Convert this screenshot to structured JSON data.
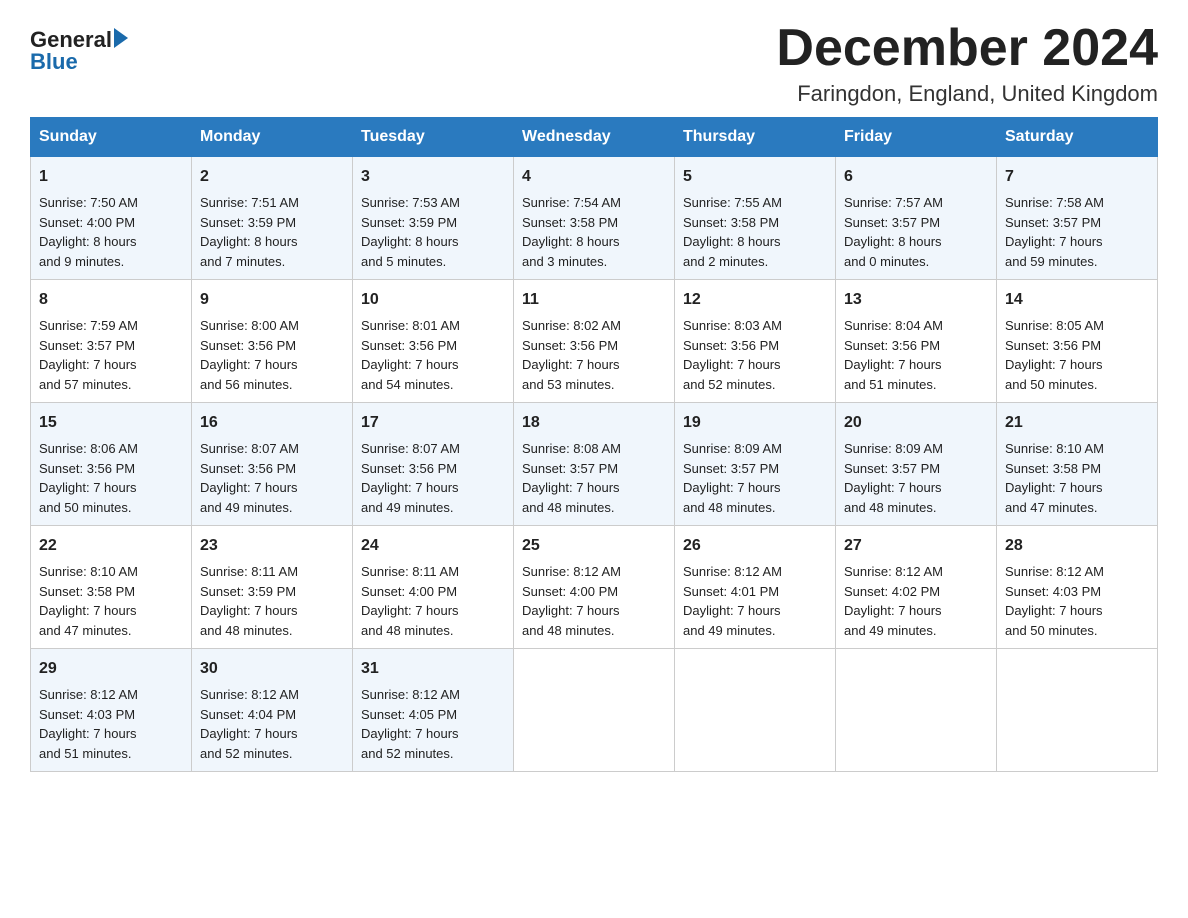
{
  "header": {
    "month_title": "December 2024",
    "location": "Faringdon, England, United Kingdom",
    "logo_general": "General",
    "logo_blue": "Blue"
  },
  "days_of_week": [
    "Sunday",
    "Monday",
    "Tuesday",
    "Wednesday",
    "Thursday",
    "Friday",
    "Saturday"
  ],
  "weeks": [
    [
      {
        "day": "1",
        "info": "Sunrise: 7:50 AM\nSunset: 4:00 PM\nDaylight: 8 hours\nand 9 minutes."
      },
      {
        "day": "2",
        "info": "Sunrise: 7:51 AM\nSunset: 3:59 PM\nDaylight: 8 hours\nand 7 minutes."
      },
      {
        "day": "3",
        "info": "Sunrise: 7:53 AM\nSunset: 3:59 PM\nDaylight: 8 hours\nand 5 minutes."
      },
      {
        "day": "4",
        "info": "Sunrise: 7:54 AM\nSunset: 3:58 PM\nDaylight: 8 hours\nand 3 minutes."
      },
      {
        "day": "5",
        "info": "Sunrise: 7:55 AM\nSunset: 3:58 PM\nDaylight: 8 hours\nand 2 minutes."
      },
      {
        "day": "6",
        "info": "Sunrise: 7:57 AM\nSunset: 3:57 PM\nDaylight: 8 hours\nand 0 minutes."
      },
      {
        "day": "7",
        "info": "Sunrise: 7:58 AM\nSunset: 3:57 PM\nDaylight: 7 hours\nand 59 minutes."
      }
    ],
    [
      {
        "day": "8",
        "info": "Sunrise: 7:59 AM\nSunset: 3:57 PM\nDaylight: 7 hours\nand 57 minutes."
      },
      {
        "day": "9",
        "info": "Sunrise: 8:00 AM\nSunset: 3:56 PM\nDaylight: 7 hours\nand 56 minutes."
      },
      {
        "day": "10",
        "info": "Sunrise: 8:01 AM\nSunset: 3:56 PM\nDaylight: 7 hours\nand 54 minutes."
      },
      {
        "day": "11",
        "info": "Sunrise: 8:02 AM\nSunset: 3:56 PM\nDaylight: 7 hours\nand 53 minutes."
      },
      {
        "day": "12",
        "info": "Sunrise: 8:03 AM\nSunset: 3:56 PM\nDaylight: 7 hours\nand 52 minutes."
      },
      {
        "day": "13",
        "info": "Sunrise: 8:04 AM\nSunset: 3:56 PM\nDaylight: 7 hours\nand 51 minutes."
      },
      {
        "day": "14",
        "info": "Sunrise: 8:05 AM\nSunset: 3:56 PM\nDaylight: 7 hours\nand 50 minutes."
      }
    ],
    [
      {
        "day": "15",
        "info": "Sunrise: 8:06 AM\nSunset: 3:56 PM\nDaylight: 7 hours\nand 50 minutes."
      },
      {
        "day": "16",
        "info": "Sunrise: 8:07 AM\nSunset: 3:56 PM\nDaylight: 7 hours\nand 49 minutes."
      },
      {
        "day": "17",
        "info": "Sunrise: 8:07 AM\nSunset: 3:56 PM\nDaylight: 7 hours\nand 49 minutes."
      },
      {
        "day": "18",
        "info": "Sunrise: 8:08 AM\nSunset: 3:57 PM\nDaylight: 7 hours\nand 48 minutes."
      },
      {
        "day": "19",
        "info": "Sunrise: 8:09 AM\nSunset: 3:57 PM\nDaylight: 7 hours\nand 48 minutes."
      },
      {
        "day": "20",
        "info": "Sunrise: 8:09 AM\nSunset: 3:57 PM\nDaylight: 7 hours\nand 48 minutes."
      },
      {
        "day": "21",
        "info": "Sunrise: 8:10 AM\nSunset: 3:58 PM\nDaylight: 7 hours\nand 47 minutes."
      }
    ],
    [
      {
        "day": "22",
        "info": "Sunrise: 8:10 AM\nSunset: 3:58 PM\nDaylight: 7 hours\nand 47 minutes."
      },
      {
        "day": "23",
        "info": "Sunrise: 8:11 AM\nSunset: 3:59 PM\nDaylight: 7 hours\nand 48 minutes."
      },
      {
        "day": "24",
        "info": "Sunrise: 8:11 AM\nSunset: 4:00 PM\nDaylight: 7 hours\nand 48 minutes."
      },
      {
        "day": "25",
        "info": "Sunrise: 8:12 AM\nSunset: 4:00 PM\nDaylight: 7 hours\nand 48 minutes."
      },
      {
        "day": "26",
        "info": "Sunrise: 8:12 AM\nSunset: 4:01 PM\nDaylight: 7 hours\nand 49 minutes."
      },
      {
        "day": "27",
        "info": "Sunrise: 8:12 AM\nSunset: 4:02 PM\nDaylight: 7 hours\nand 49 minutes."
      },
      {
        "day": "28",
        "info": "Sunrise: 8:12 AM\nSunset: 4:03 PM\nDaylight: 7 hours\nand 50 minutes."
      }
    ],
    [
      {
        "day": "29",
        "info": "Sunrise: 8:12 AM\nSunset: 4:03 PM\nDaylight: 7 hours\nand 51 minutes."
      },
      {
        "day": "30",
        "info": "Sunrise: 8:12 AM\nSunset: 4:04 PM\nDaylight: 7 hours\nand 52 minutes."
      },
      {
        "day": "31",
        "info": "Sunrise: 8:12 AM\nSunset: 4:05 PM\nDaylight: 7 hours\nand 52 minutes."
      },
      {
        "day": "",
        "info": ""
      },
      {
        "day": "",
        "info": ""
      },
      {
        "day": "",
        "info": ""
      },
      {
        "day": "",
        "info": ""
      }
    ]
  ]
}
